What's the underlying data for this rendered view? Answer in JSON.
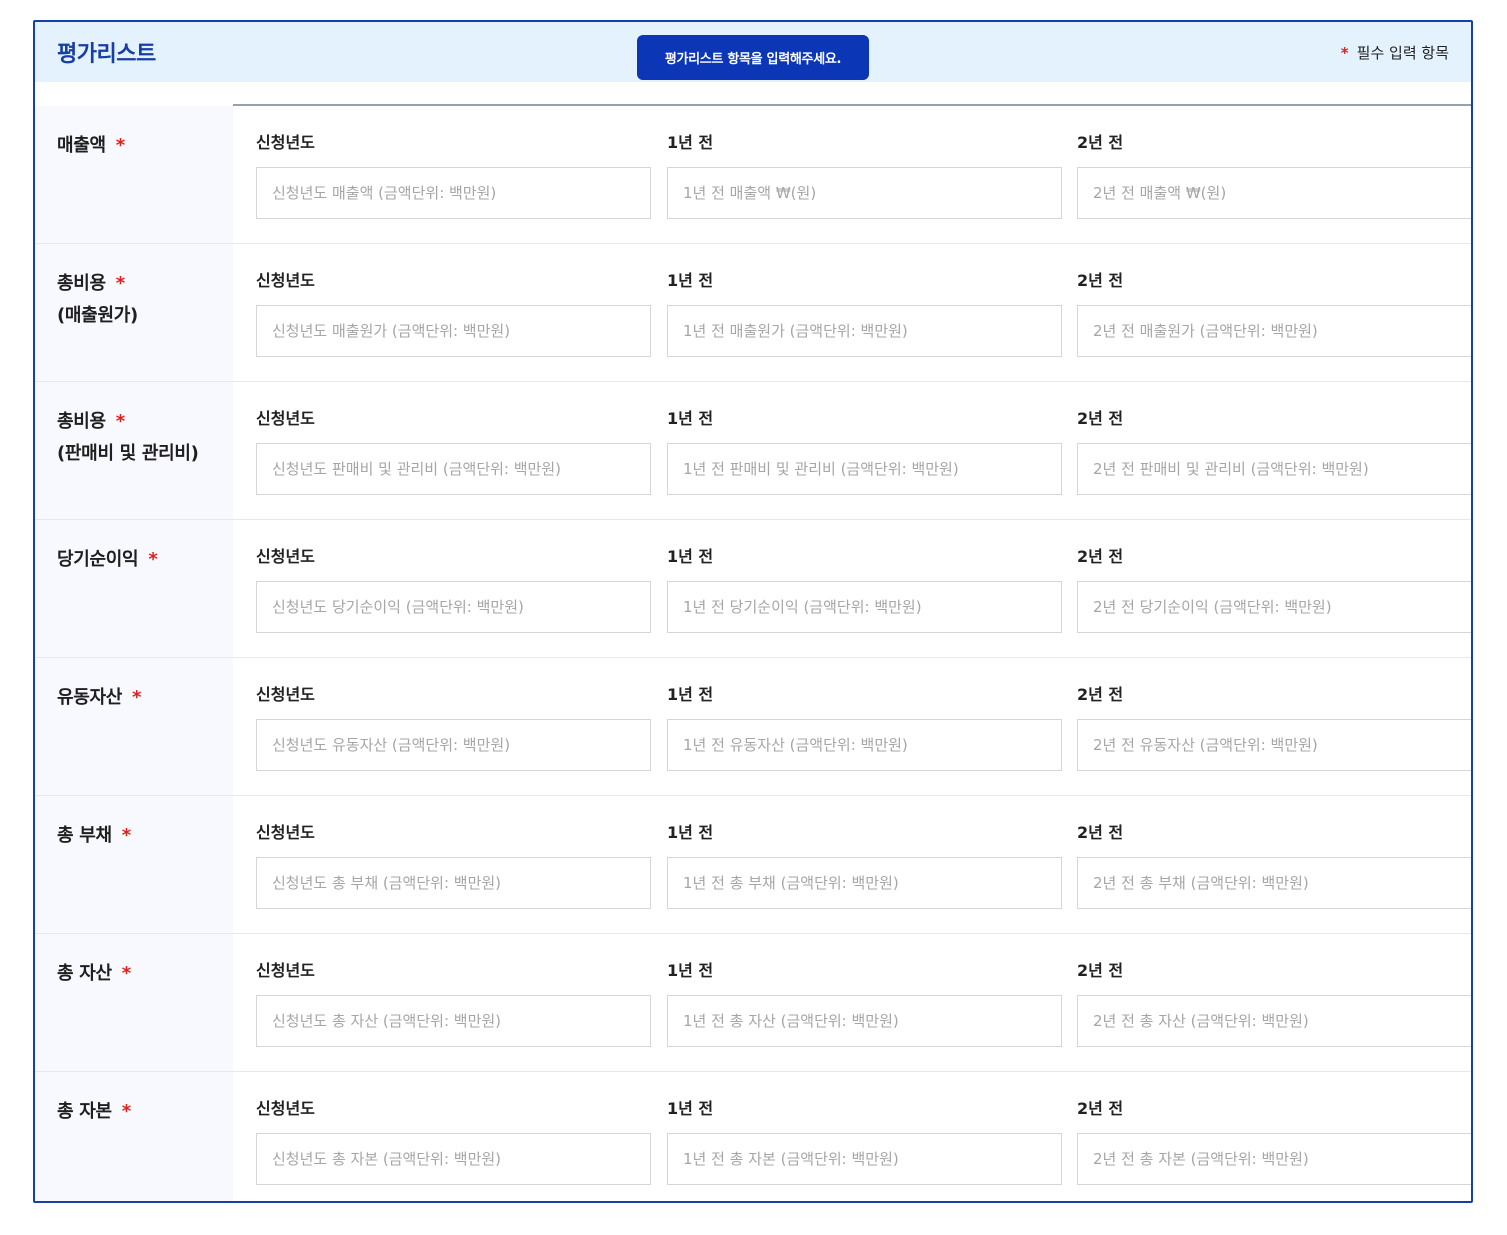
{
  "header": {
    "title": "평가리스트",
    "tooltip": "평가리스트 항목을 입력해주세요.",
    "required_star": "*",
    "required_text": "필수 입력 항목"
  },
  "columns": {
    "current": "신청년도",
    "prev1": "1년 전",
    "prev2": "2년 전"
  },
  "rows": [
    {
      "label1": "매출액",
      "label2": "",
      "star": "*",
      "placeholders": [
        "신청년도 매출액 (금액단위: 백만원)",
        "1년 전 매출액 ₩(원)",
        "2년 전 매출액 ₩(원)"
      ]
    },
    {
      "label1": "총비용",
      "label2": "(매출원가)",
      "star": "*",
      "placeholders": [
        "신청년도 매출원가 (금액단위: 백만원)",
        "1년 전 매출원가 (금액단위: 백만원)",
        "2년 전 매출원가 (금액단위: 백만원)"
      ]
    },
    {
      "label1": "총비용",
      "label2": "(판매비 및 관리비)",
      "star": "*",
      "placeholders": [
        "신청년도 판매비 및 관리비 (금액단위: 백만원)",
        "1년 전 판매비 및 관리비 (금액단위: 백만원)",
        "2년 전 판매비 및 관리비 (금액단위: 백만원)"
      ]
    },
    {
      "label1": "당기순이익",
      "label2": "",
      "star": "*",
      "placeholders": [
        "신청년도 당기순이익 (금액단위: 백만원)",
        "1년 전 당기순이익 (금액단위: 백만원)",
        "2년 전 당기순이익 (금액단위: 백만원)"
      ]
    },
    {
      "label1": "유동자산",
      "label2": "",
      "star": "*",
      "placeholders": [
        "신청년도 유동자산 (금액단위: 백만원)",
        "1년 전 유동자산 (금액단위: 백만원)",
        "2년 전 유동자산 (금액단위: 백만원)"
      ]
    },
    {
      "label1": "총 부채",
      "label2": "",
      "star": "*",
      "placeholders": [
        "신청년도 총 부채 (금액단위: 백만원)",
        "1년 전 총 부채 (금액단위: 백만원)",
        "2년 전 총 부채 (금액단위: 백만원)"
      ]
    },
    {
      "label1": "총 자산",
      "label2": "",
      "star": "*",
      "placeholders": [
        "신청년도 총 자산 (금액단위: 백만원)",
        "1년 전 총 자산 (금액단위: 백만원)",
        "2년 전 총 자산 (금액단위: 백만원)"
      ]
    },
    {
      "label1": "총 자본",
      "label2": "",
      "star": "*",
      "placeholders": [
        "신청년도 총 자본 (금액단위: 백만원)",
        "1년 전 총 자본 (금액단위: 백만원)",
        "2년 전 총 자본 (금액단위: 백만원)"
      ]
    }
  ],
  "colors": {
    "accent": "#173ea5",
    "tooltip_bg": "#0b36b5",
    "header_bg": "#e3f2fd",
    "required": "#e0201b",
    "label_bg": "#f8f9ff"
  }
}
